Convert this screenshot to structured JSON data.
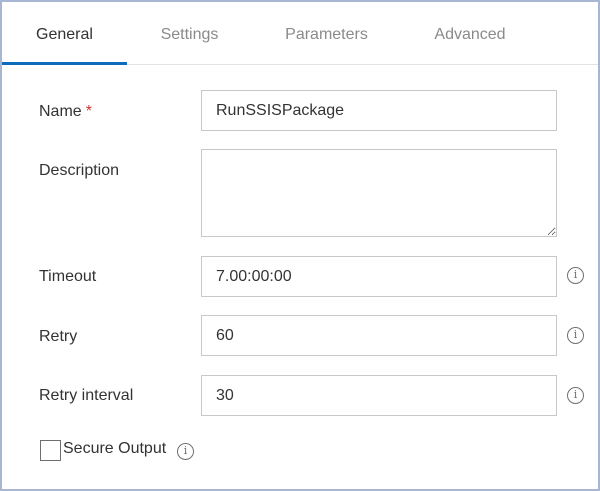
{
  "tabs": [
    {
      "label": "General",
      "active": true
    },
    {
      "label": "Settings",
      "active": false
    },
    {
      "label": "Parameters",
      "active": false
    },
    {
      "label": "Advanced",
      "active": false
    }
  ],
  "form": {
    "name": {
      "label": "Name",
      "required_mark": "*",
      "value": "RunSSISPackage"
    },
    "description": {
      "label": "Description",
      "value": ""
    },
    "timeout": {
      "label": "Timeout",
      "value": "7.00:00:00"
    },
    "retry": {
      "label": "Retry",
      "value": "60"
    },
    "retry_interval": {
      "label": "Retry interval",
      "value": "30"
    },
    "secure_output": {
      "label": "Secure Output",
      "checked": false
    }
  },
  "icons": {
    "info": "info-icon",
    "info_glyph": "i"
  },
  "colors": {
    "accent": "#0f6cbd",
    "required": "#d13438",
    "frame_border": "#a7b7d3"
  }
}
